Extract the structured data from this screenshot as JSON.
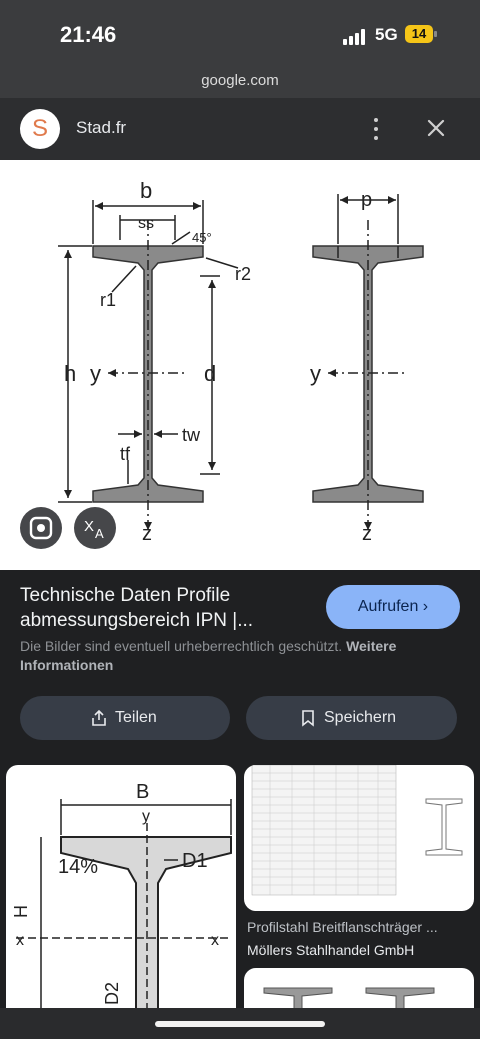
{
  "status_bar": {
    "time": "21:46",
    "network": "5G",
    "battery": "14"
  },
  "browser": {
    "url": "google.com"
  },
  "source": {
    "logo_letter": "S",
    "site_name": "Stad.fr"
  },
  "image": {
    "labels": {
      "b": "b",
      "ss": "ss",
      "angle": "45°",
      "r2": "r2",
      "r1": "r1",
      "h": "h",
      "y": "y",
      "d": "d",
      "tw": "tw",
      "tf": "tf",
      "z": "z",
      "p": "p"
    }
  },
  "result": {
    "title": "Technische Daten Profile abmessungsbereich IPN |...",
    "visit_label": "Aufrufen",
    "legal_text": "Die Bilder sind eventuell urheberrechtlich geschützt.",
    "legal_link": "Weitere Informationen"
  },
  "actions": {
    "share_label": "Teilen",
    "save_label": "Speichern"
  },
  "related": [
    {
      "labels": {
        "B": "B",
        "y": "y",
        "pct": "14%",
        "D1": "D1",
        "H": "H",
        "x": "x",
        "D2": "D2"
      }
    },
    {
      "title": "Profilstahl Breitflanschträger ...",
      "source": "Möllers Stahlhandel GmbH"
    },
    {}
  ],
  "icons": [
    "signal-icon",
    "battery-icon",
    "more-vert-icon",
    "close-icon",
    "lens-icon",
    "translate-icon",
    "chevron-right-icon",
    "share-icon",
    "bookmark-icon"
  ]
}
